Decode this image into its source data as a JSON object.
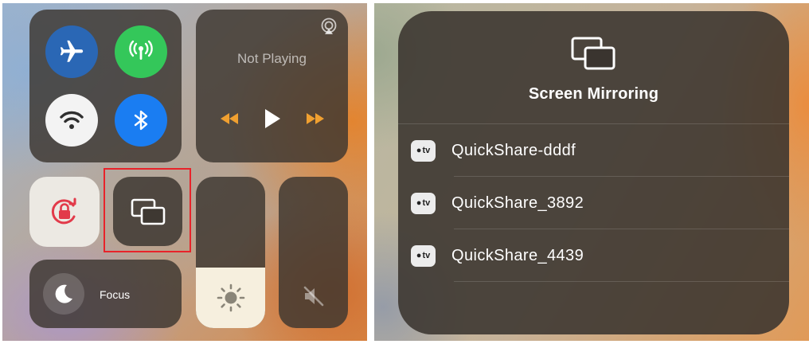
{
  "control_center": {
    "connectivity": {
      "airplane_icon": "airplane-icon",
      "cellular_icon": "cellular-antenna-icon",
      "wifi_icon": "wifi-icon",
      "bluetooth_icon": "bluetooth-icon"
    },
    "media": {
      "now_playing": "Not Playing",
      "airplay_icon": "airplay-audio-icon"
    },
    "focus": {
      "label": "Focus",
      "icon": "moon-icon"
    },
    "brightness": {
      "level": 0.4,
      "icon": "sun-icon"
    },
    "volume": {
      "level": 0.0,
      "icon": "speaker-muted-icon"
    },
    "highlight_color": "#e8232a"
  },
  "screen_mirroring": {
    "title": "Screen Mirroring",
    "icon": "screen-mirroring-icon",
    "devices": [
      {
        "name": "QuickShare-dddf",
        "badge": "tv"
      },
      {
        "name": "QuickShare_3892",
        "badge": "tv"
      },
      {
        "name": "QuickShare_4439",
        "badge": "tv"
      }
    ]
  },
  "colors": {
    "airplane": "#2a67b5",
    "cellular": "#34c75a",
    "bluetooth": "#1a7df2",
    "media_accent": "#f0a030"
  }
}
